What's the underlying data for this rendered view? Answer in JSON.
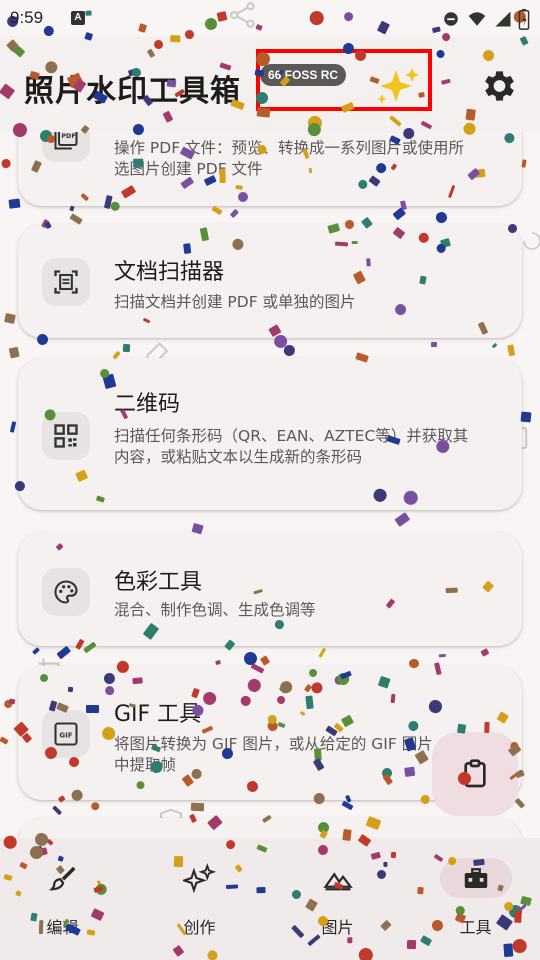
{
  "status_bar": {
    "time": "9:59",
    "notification_letter": "A"
  },
  "header": {
    "title": "照片水印工具箱",
    "badge": "66 FOSS RC",
    "sparkle_icon": "sparkles-icon",
    "settings_icon": "gear-icon"
  },
  "cards": [
    {
      "name": "pdf-tools",
      "title": "",
      "description": "操作 PDF 文件：预览、转换成一系列图片或使用所选图片创建 PDF 文件",
      "icon": "pdf-icon"
    },
    {
      "name": "document-scanner",
      "title": "文档扫描器",
      "description": "扫描文档并创建 PDF 或单独的图片",
      "icon": "document-scanner-icon"
    },
    {
      "name": "qr-code",
      "title": "二维码",
      "description": "扫描任何条形码（QR、EAN、AZTEC等）并获取其内容，或粘贴文本以生成新的条形码",
      "icon": "qr-code-icon"
    },
    {
      "name": "color-tools",
      "title": "色彩工具",
      "description": "混合、制作色调、生成色调等",
      "icon": "palette-icon"
    },
    {
      "name": "gif-tools",
      "title": "GIF 工具",
      "description": "将图片转换为 GIF 图片，或从给定的 GIF 图片中提取帧",
      "icon": "gif-icon"
    }
  ],
  "fab": {
    "icon": "clipboard-icon"
  },
  "bottom_nav": [
    {
      "name": "edit",
      "label": "编辑",
      "icon": "brush-icon",
      "active": false
    },
    {
      "name": "create",
      "label": "创作",
      "icon": "sparkles-outline-icon",
      "active": false
    },
    {
      "name": "images",
      "label": "图片",
      "icon": "landscape-icon",
      "active": false
    },
    {
      "name": "tools",
      "label": "工具",
      "icon": "toolbox-icon",
      "active": true
    }
  ],
  "colors": {
    "background": "#f8f5f4",
    "card": "#f5f1f0",
    "icon_tile": "#e7e3e2",
    "active_pill": "#e8d8dc",
    "fab": "#f0dde2",
    "highlight_box": "#ff0000",
    "confetti": [
      "#1f3a93",
      "#2e7d6e",
      "#7b4fa0",
      "#c0392b",
      "#d4a017",
      "#8e6f4e",
      "#3a3a7a",
      "#a33a6a",
      "#5a8f3a",
      "#b85a2a"
    ]
  }
}
